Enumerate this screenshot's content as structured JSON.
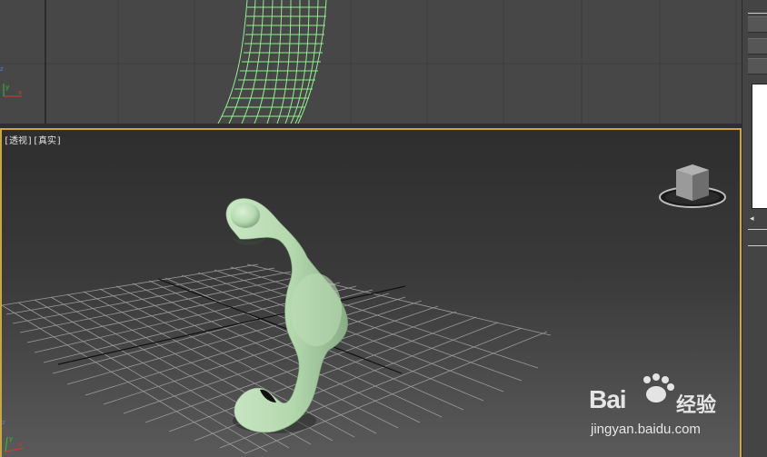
{
  "app": {
    "window_title": ""
  },
  "viewports": {
    "top": {
      "name": "top-viewport",
      "wireframe_color": "#8ef08e"
    },
    "main": {
      "label": "[透视][真实]",
      "active_border_color": "#c9a83e",
      "object_color": "#b8dcb4"
    }
  },
  "viewcube": {
    "icon": "viewcube-icon"
  },
  "axis_gizmo": {
    "icon": "axis-tripod-icon",
    "x_label": "x",
    "y_label": "y",
    "z_label": "z",
    "colors": {
      "x": "#e03030",
      "y": "#30c030",
      "z": "#3060e0"
    }
  },
  "watermark": {
    "logo_text": "Bai",
    "logo_text_2": "经验",
    "url_text": "jingyan.baidu.com",
    "icon": "baidu-paw-icon"
  },
  "command_panel": {
    "icon": "command-panel-strip"
  }
}
